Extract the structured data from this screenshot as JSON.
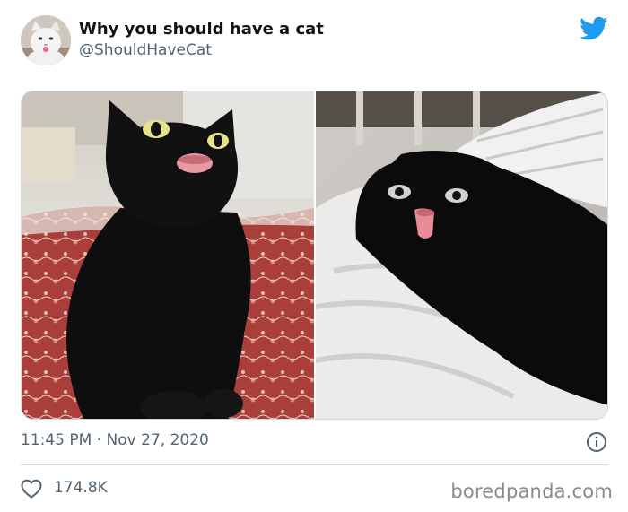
{
  "tweet": {
    "author_name": "Why you should have a cat",
    "author_handle": "@ShouldHaveCat",
    "time": "11:45 PM",
    "separator": "·",
    "date": "Nov 27, 2020",
    "likes": "174.8K"
  },
  "watermark": "boredpanda.com",
  "icons": {
    "brand": "twitter-bird-icon",
    "info": "info-icon",
    "like": "heart-icon"
  },
  "colors": {
    "twitter_blue": "#1d9bf0",
    "secondary_text": "#536471",
    "primary_text": "#0f1419",
    "divider": "#cfd9de"
  }
}
